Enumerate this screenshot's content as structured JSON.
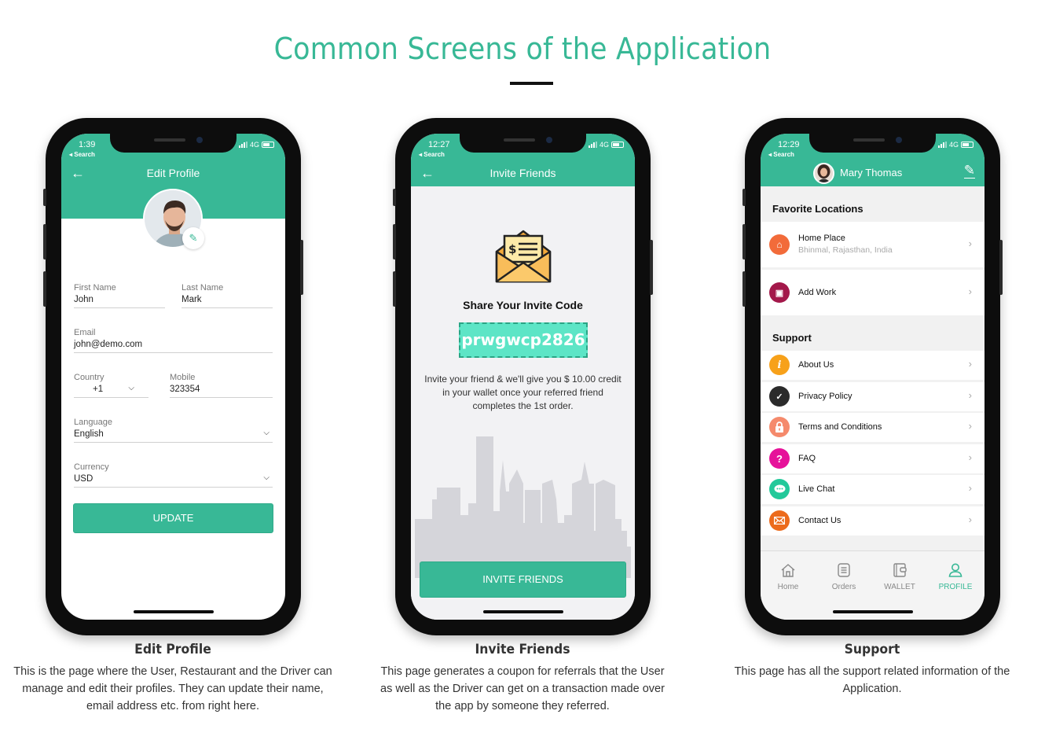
{
  "page": {
    "title": "Common Screens of the Application",
    "accent_color": "#38b896"
  },
  "phones": [
    {
      "status": {
        "time": "1:39",
        "back_label": "Search",
        "network": "4G"
      },
      "screen_title": "Edit Profile",
      "fields": {
        "first_name": {
          "label": "First Name",
          "value": "John"
        },
        "last_name": {
          "label": "Last Name",
          "value": "Mark"
        },
        "email": {
          "label": "Email",
          "value": "john@demo.com"
        },
        "country": {
          "label": "Country",
          "value": "+1"
        },
        "mobile": {
          "label": "Mobile",
          "value": "323354"
        },
        "language": {
          "label": "Language",
          "value": "English"
        },
        "currency": {
          "label": "Currency",
          "value": "USD"
        }
      },
      "button_label": "UPDATE"
    },
    {
      "status": {
        "time": "12:27",
        "back_label": "Search",
        "network": "4G"
      },
      "screen_title": "Invite Friends",
      "heading": "Share Your Invite Code",
      "invite_code": "prwgwcp2826",
      "description": "Invite your friend & we'll give you $ 10.00 credit in your wallet once your referred friend completes the 1st order.",
      "button_label": "INVITE FRIENDS"
    },
    {
      "status": {
        "time": "12:29",
        "back_label": "Search",
        "network": "4G"
      },
      "user_name": "Mary Thomas",
      "favorite_locations": {
        "title": "Favorite Locations",
        "items": [
          {
            "label": "Home Place",
            "sub": "Bhinmal, Rajasthan, India",
            "icon": "home-pin-icon",
            "color": "#f26b3a"
          },
          {
            "label": "Add Work",
            "sub": "",
            "icon": "work-pin-icon",
            "color": "#a3184a"
          }
        ]
      },
      "support": {
        "title": "Support",
        "items": [
          {
            "label": "About Us",
            "icon": "info-icon",
            "glyph": "i",
            "color": "#f7a11a"
          },
          {
            "label": "Privacy Policy",
            "icon": "privacy-lock-icon",
            "glyph": "🔒",
            "color": "#2b2b2b"
          },
          {
            "label": "Terms and Conditions",
            "icon": "lock-icon",
            "glyph": "🔒",
            "color": "#f58a6c"
          },
          {
            "label": "FAQ",
            "icon": "question-icon",
            "glyph": "?",
            "color": "#e6129a"
          },
          {
            "label": "Live Chat",
            "icon": "chat-icon",
            "glyph": "💬",
            "color": "#22c99a"
          },
          {
            "label": "Contact Us",
            "icon": "mail-icon",
            "glyph": "✉",
            "color": "#ec6b1c"
          }
        ]
      },
      "tabs": [
        {
          "label": "Home",
          "icon": "home-icon",
          "glyph": "⌂"
        },
        {
          "label": "Orders",
          "icon": "orders-icon",
          "glyph": "☰"
        },
        {
          "label": "WALLET",
          "icon": "wallet-icon",
          "glyph": "▣"
        },
        {
          "label": "PROFILE",
          "icon": "profile-icon",
          "glyph": "👤",
          "active": true
        }
      ]
    }
  ],
  "captions": [
    {
      "title": "Edit Profile",
      "text": "This is the page where the User, Restaurant and the Driver can manage and edit their profiles. They can update their name, email address etc. from right here."
    },
    {
      "title": "Invite Friends",
      "text": "This page generates a coupon for referrals that the User as well as the Driver can get on a transaction made over the app by someone they referred."
    },
    {
      "title": "Support",
      "text": "This page has all the support related information of the Application."
    }
  ]
}
